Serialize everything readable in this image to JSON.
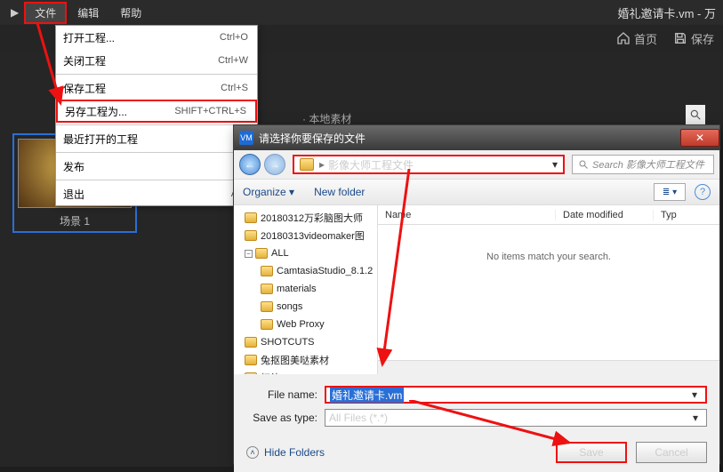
{
  "menubar": {
    "tabs": [
      "文件",
      "编辑",
      "帮助"
    ],
    "title": "婚礼邀请卡.vm - 万"
  },
  "subbar": {
    "home": "首页",
    "save": "保存"
  },
  "dropdown": {
    "items": [
      {
        "label": "打开工程...",
        "short": "Ctrl+O"
      },
      {
        "label": "关闭工程",
        "short": "Ctrl+W"
      },
      {
        "label": "保存工程",
        "short": "Ctrl+S"
      },
      {
        "label": "另存工程为...",
        "short": "SHIFT+CTRL+S",
        "highlight": true
      },
      {
        "label": "最近打开的工程",
        "short": ""
      },
      {
        "label": "发布",
        "short": ""
      },
      {
        "label": "退出",
        "short": "Alt+"
      }
    ]
  },
  "breadcrumb_hint": "本地素材",
  "scene": {
    "caption": "场景 1"
  },
  "dialog": {
    "title": "请选择你要保存的文件",
    "crumb": "影像大师工程文件",
    "search_placeholder": "Search 影像大师工程文件",
    "organize": "Organize",
    "newfolder": "New folder",
    "columns": {
      "name": "Name",
      "date": "Date modified",
      "type": "Typ"
    },
    "empty": "No items match your search.",
    "tree": [
      "20180312万彩脑图大师",
      "20180313videomaker图",
      "ALL",
      "CamtasiaStudio_8.1.2",
      "materials",
      "songs",
      "Web Proxy",
      "SHOTCUTS",
      "兔抠图美哒素材",
      "权律二"
    ],
    "filename_label": "File name:",
    "filename_value": "婚礼邀请卡.vm",
    "savetype_label": "Save as type:",
    "savetype_value": "All Files (*.*)",
    "hide_folders": "Hide Folders",
    "save_btn": "Save",
    "cancel_btn": "Cancel"
  }
}
